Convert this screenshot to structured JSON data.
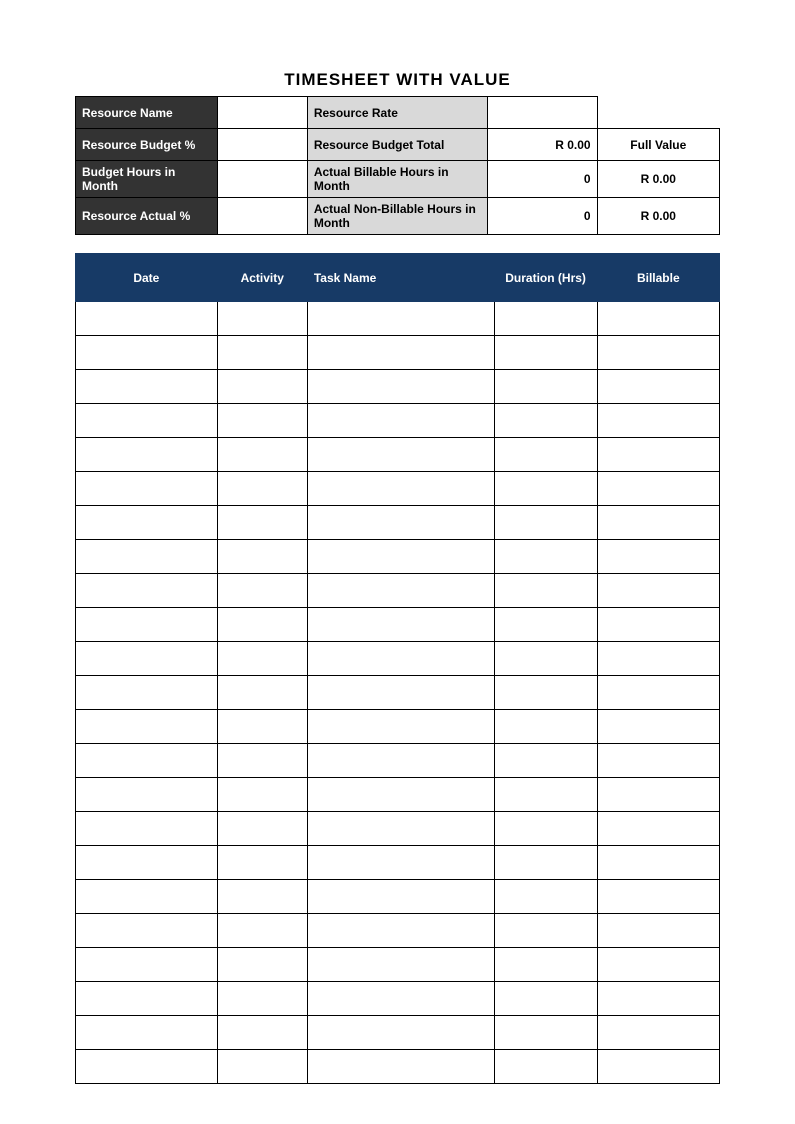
{
  "title": "TIMESHEET WITH VALUE",
  "summary": {
    "row1": {
      "labelA": "Resource Name",
      "valA": "",
      "labelB": "Resource Rate",
      "valB": ""
    },
    "row2": {
      "labelA": "Resource Budget %",
      "valA": "",
      "labelB": "Resource Budget Total",
      "valB": "R 0.00",
      "labelC": "Full Value"
    },
    "row3": {
      "labelA": "Budget Hours in Month",
      "valA": "",
      "labelB": "Actual Billable Hours in Month",
      "valB": "0",
      "valC": "R 0.00"
    },
    "row4": {
      "labelA": "Resource Actual %",
      "valA": "",
      "labelB": "Actual Non-Billable Hours in Month",
      "valB": "0",
      "valC": "R 0.00"
    }
  },
  "entries": {
    "headers": {
      "date": "Date",
      "activity": "Activity",
      "task": "Task Name",
      "duration": "Duration (Hrs)",
      "billable": "Billable"
    },
    "row_count": 23
  }
}
